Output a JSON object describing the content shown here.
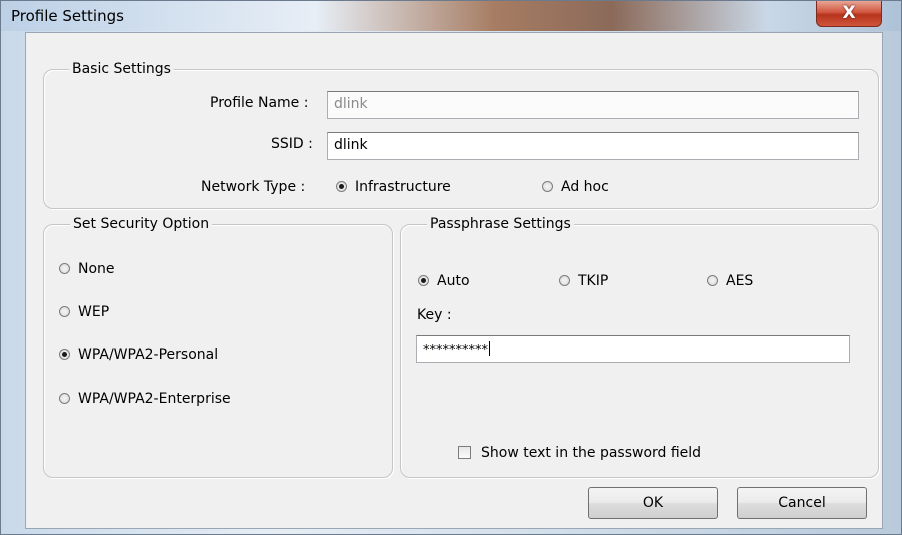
{
  "window": {
    "title": "Profile Settings",
    "close_label": "X"
  },
  "basic": {
    "legend": "Basic Settings",
    "profile_name_label": "Profile Name :",
    "profile_name_value": "dlink",
    "ssid_label": "SSID :",
    "ssid_value": "dlink",
    "network_type_label": "Network Type :",
    "network_types": [
      {
        "label": "Infrastructure",
        "selected": true
      },
      {
        "label": "Ad hoc",
        "selected": false
      }
    ]
  },
  "security": {
    "legend": "Set Security Option",
    "options": [
      {
        "label": "None",
        "selected": false
      },
      {
        "label": "WEP",
        "selected": false
      },
      {
        "label": "WPA/WPA2-Personal",
        "selected": true
      },
      {
        "label": "WPA/WPA2-Enterprise",
        "selected": false
      }
    ]
  },
  "passphrase": {
    "legend": "Passphrase Settings",
    "ciphers": [
      {
        "label": "Auto",
        "selected": true
      },
      {
        "label": "TKIP",
        "selected": false
      },
      {
        "label": "AES",
        "selected": false
      }
    ],
    "key_label": "Key :",
    "key_value": "**********",
    "show_text_label": "Show text in the password field",
    "show_text_checked": false
  },
  "buttons": {
    "ok": "OK",
    "cancel": "Cancel"
  }
}
